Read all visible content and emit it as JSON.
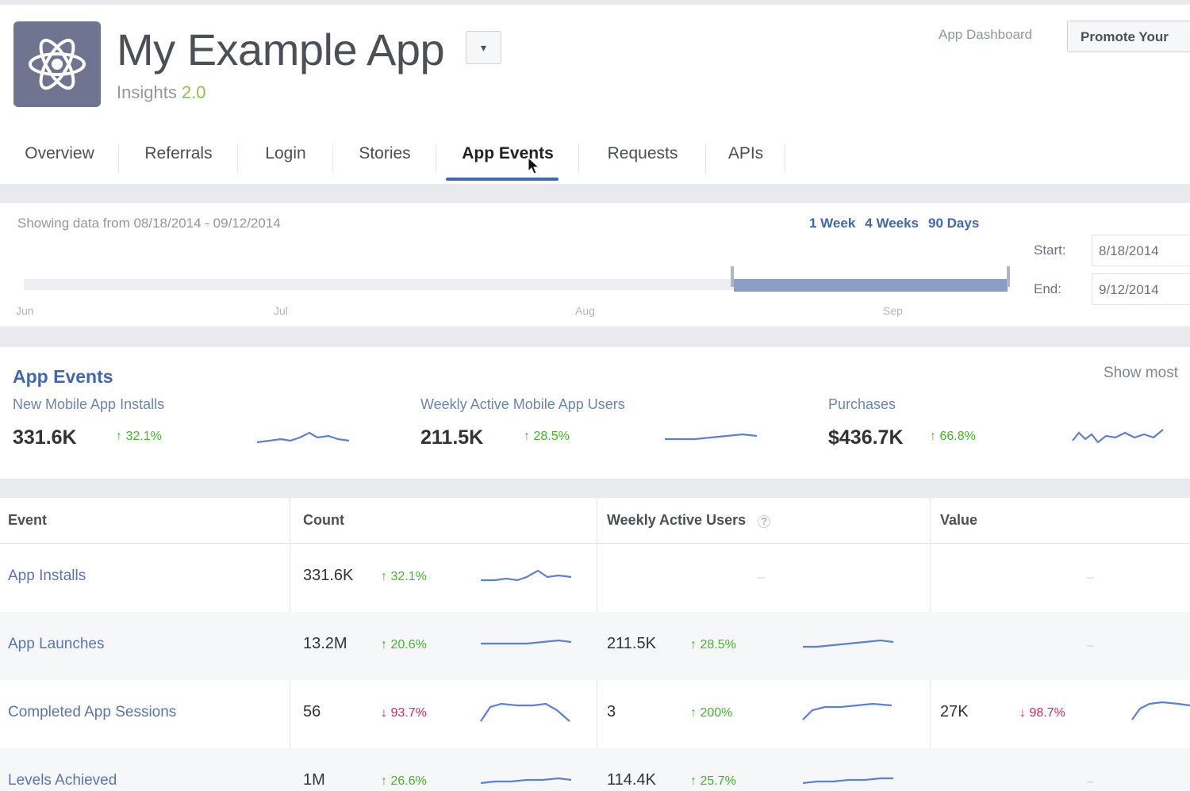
{
  "header": {
    "app_title": "My Example App",
    "dropdown_glyph": "▾",
    "subtitle_prefix": "Insights",
    "subtitle_version": "2.0",
    "app_dashboard_link": "App Dashboard",
    "promote_label": "Promote Your"
  },
  "tabs": [
    {
      "label": "Overview"
    },
    {
      "label": "Referrals"
    },
    {
      "label": "Login"
    },
    {
      "label": "Stories"
    },
    {
      "label": "App Events"
    },
    {
      "label": "Requests"
    },
    {
      "label": "APIs"
    }
  ],
  "date_range": {
    "text": "Showing data from 08/18/2014 - 09/12/2014",
    "links": [
      "1 Week",
      "4 Weeks",
      "90 Days"
    ],
    "month_ticks": [
      "Jun",
      "Jul",
      "Aug",
      "Sep"
    ],
    "start_label": "Start:",
    "start_value": "8/18/2014",
    "end_label": "End:",
    "end_value": "9/12/2014"
  },
  "summary": {
    "title": "App Events",
    "show_most": "Show most",
    "metrics": [
      {
        "label": "New Mobile App Installs",
        "value": "331.6K",
        "delta": "↑ 32.1%"
      },
      {
        "label": "Weekly Active Mobile App Users",
        "value": "211.5K",
        "delta": "↑ 28.5%"
      },
      {
        "label": "Purchases",
        "value": "$436.7K",
        "delta": "↑ 66.8%"
      }
    ]
  },
  "table": {
    "headers": {
      "event": "Event",
      "count": "Count",
      "wau": "Weekly Active Users",
      "value": "Value"
    },
    "help_glyph": "?",
    "dash": "–",
    "rows": [
      {
        "event": "App Installs",
        "count": "331.6K",
        "count_delta": "↑ 32.1%",
        "wau": "",
        "wau_delta": "",
        "value": "",
        "value_delta": ""
      },
      {
        "event": "App Launches",
        "count": "13.2M",
        "count_delta": "↑ 20.6%",
        "wau": "211.5K",
        "wau_delta": "↑ 28.5%",
        "value": "",
        "value_delta": ""
      },
      {
        "event": "Completed App Sessions",
        "count": "56",
        "count_delta": "↓ 93.7%",
        "wau": "3",
        "wau_delta": "↑ 200%",
        "value": "27K",
        "value_delta": "↓ 98.7%"
      },
      {
        "event": "Levels Achieved",
        "count": "1M",
        "count_delta": "↑ 26.6%",
        "wau": "114.4K",
        "wau_delta": "↑ 25.7%",
        "value": "",
        "value_delta": ""
      }
    ]
  },
  "colors": {
    "accent": "#4267b2",
    "up": "#42b72a",
    "down": "#e0245e",
    "spark": "#5c7fd9"
  }
}
